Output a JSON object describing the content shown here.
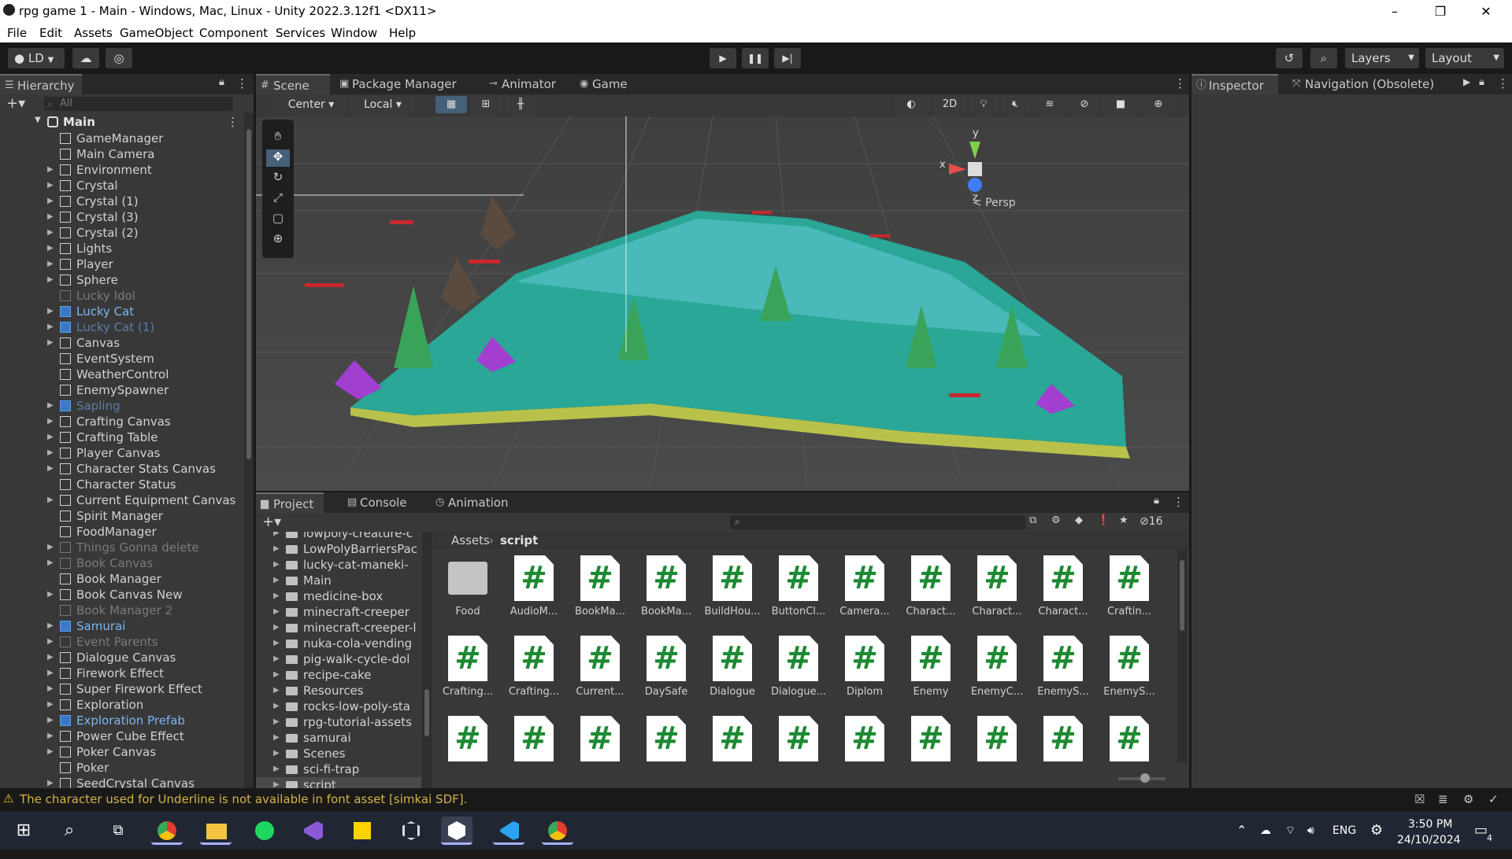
{
  "window": {
    "title": "rpg game 1 - Main - Windows, Mac, Linux - Unity 2022.3.12f1 <DX11>",
    "min": "–",
    "max": "❐",
    "close": "✕"
  },
  "menu": [
    "File",
    "Edit",
    "Assets",
    "GameObject",
    "Component",
    "Services",
    "Window",
    "Help"
  ],
  "toolbar": {
    "account": "LD",
    "layers": "Layers",
    "layout": "Layout"
  },
  "hierarchy": {
    "tab": "Hierarchy",
    "search_placeholder": "All",
    "root": "Main",
    "items": [
      {
        "label": "GameManager",
        "arrow": false,
        "style": "normal"
      },
      {
        "label": "Main Camera",
        "arrow": false,
        "style": "normal"
      },
      {
        "label": "Environment",
        "arrow": true,
        "style": "normal"
      },
      {
        "label": "Crystal",
        "arrow": true,
        "style": "normal"
      },
      {
        "label": "Crystal (1)",
        "arrow": true,
        "style": "normal"
      },
      {
        "label": "Crystal (3)",
        "arrow": true,
        "style": "normal"
      },
      {
        "label": "Crystal (2)",
        "arrow": true,
        "style": "normal"
      },
      {
        "label": "Lights",
        "arrow": true,
        "style": "normal"
      },
      {
        "label": "Player",
        "arrow": true,
        "style": "normal"
      },
      {
        "label": "Sphere",
        "arrow": true,
        "style": "normal"
      },
      {
        "label": "Lucky Idol",
        "arrow": false,
        "style": "dim"
      },
      {
        "label": "Lucky Cat",
        "arrow": true,
        "style": "prefab"
      },
      {
        "label": "Lucky Cat (1)",
        "arrow": true,
        "style": "prefab-dim"
      },
      {
        "label": "Canvas",
        "arrow": true,
        "style": "normal"
      },
      {
        "label": "EventSystem",
        "arrow": false,
        "style": "normal"
      },
      {
        "label": "WeatherControl",
        "arrow": false,
        "style": "normal"
      },
      {
        "label": "EnemySpawner",
        "arrow": false,
        "style": "normal"
      },
      {
        "label": "Sapling",
        "arrow": true,
        "style": "prefab-dim"
      },
      {
        "label": "Crafting Canvas",
        "arrow": true,
        "style": "normal"
      },
      {
        "label": "Crafting Table",
        "arrow": true,
        "style": "normal"
      },
      {
        "label": "Player Canvas",
        "arrow": true,
        "style": "normal"
      },
      {
        "label": "Character Stats Canvas",
        "arrow": true,
        "style": "normal"
      },
      {
        "label": "Character Status",
        "arrow": false,
        "style": "normal"
      },
      {
        "label": "Current Equipment Canvas",
        "arrow": true,
        "style": "normal"
      },
      {
        "label": "Spirit Manager",
        "arrow": false,
        "style": "normal"
      },
      {
        "label": "FoodManager",
        "arrow": false,
        "style": "normal"
      },
      {
        "label": "Things Gonna delete",
        "arrow": true,
        "style": "dim"
      },
      {
        "label": "Book Canvas",
        "arrow": true,
        "style": "dim"
      },
      {
        "label": "Book Manager",
        "arrow": false,
        "style": "normal"
      },
      {
        "label": "Book Canvas New",
        "arrow": true,
        "style": "normal"
      },
      {
        "label": "Book Manager 2",
        "arrow": false,
        "style": "dim"
      },
      {
        "label": "Samurai",
        "arrow": true,
        "style": "prefab"
      },
      {
        "label": "Event Parents",
        "arrow": true,
        "style": "dim"
      },
      {
        "label": "Dialogue Canvas",
        "arrow": true,
        "style": "normal"
      },
      {
        "label": "Firework Effect",
        "arrow": true,
        "style": "normal"
      },
      {
        "label": "Super Firework Effect",
        "arrow": true,
        "style": "normal"
      },
      {
        "label": "Exploration",
        "arrow": true,
        "style": "normal"
      },
      {
        "label": "Exploration Prefab",
        "arrow": true,
        "style": "prefab"
      },
      {
        "label": "Power Cube Effect",
        "arrow": true,
        "style": "normal"
      },
      {
        "label": "Poker Canvas",
        "arrow": true,
        "style": "normal"
      },
      {
        "label": "Poker",
        "arrow": false,
        "style": "normal"
      },
      {
        "label": "SeedCrystal Canvas",
        "arrow": true,
        "style": "normal"
      }
    ]
  },
  "scene": {
    "tabs": [
      "Scene",
      "Package Manager",
      "Animator",
      "Game"
    ],
    "pivot": "Center",
    "space": "Local",
    "mode_2d": "2D",
    "persp": "< Persp",
    "gizmo": {
      "x": "x",
      "y": "y",
      "z": "z"
    }
  },
  "inspector": {
    "tabs": [
      "Inspector",
      "Navigation (Obsolete)"
    ]
  },
  "project": {
    "tabs": [
      "Project",
      "Console",
      "Animation"
    ],
    "hidden_count": "16",
    "breadcrumb": [
      "Assets",
      "script"
    ],
    "folders": [
      "lowpoly-creature-c",
      "LowPolyBarriersPac",
      "lucky-cat-maneki-",
      "Main",
      "medicine-box",
      "minecraft-creeper",
      "minecraft-creeper-l",
      "nuka-cola-vending",
      "pig-walk-cycle-dol",
      "recipe-cake",
      "Resources",
      "rocks-low-poly-sta",
      "rpg-tutorial-assets",
      "samurai",
      "Scenes",
      "sci-fi-trap",
      "script"
    ],
    "assets_row1": [
      "Food",
      "AudioM...",
      "BookMa...",
      "BookMa...",
      "BuildHou...",
      "ButtonCl...",
      "Camera...",
      "Charact...",
      "Charact...",
      "Charact...",
      "Craftin..."
    ],
    "assets_row2": [
      "Crafting...",
      "Crafting...",
      "Current...",
      "DaySafe",
      "Dialogue",
      "Dialogue...",
      "Diplom",
      "Enemy",
      "EnemyC...",
      "EnemyS...",
      "EnemyS..."
    ],
    "script_glyph": "#"
  },
  "status": {
    "warning": "The character used for Underline is not available in font asset [simkai SDF]."
  },
  "taskbar": {
    "lang": "ENG",
    "time": "3:50 PM",
    "date": "24/10/2024",
    "notif": "4"
  }
}
